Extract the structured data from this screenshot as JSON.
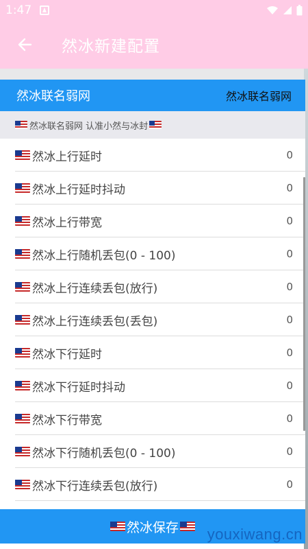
{
  "status_bar": {
    "time": "1:47",
    "icons": [
      "notification-icon",
      "wifi-icon",
      "signal-icon",
      "battery-icon"
    ]
  },
  "app_bar": {
    "back_icon": "arrow-left-icon",
    "title": "然冰新建配置"
  },
  "config": {
    "label": "然冰联名弱网",
    "value": "然冰联名弱网"
  },
  "section": {
    "text": "然冰联名弱网 认准小然与冰封"
  },
  "items": [
    {
      "label": "然冰上行延时",
      "value": "0"
    },
    {
      "label": "然冰上行延时抖动",
      "value": "0"
    },
    {
      "label": "然冰上行带宽",
      "value": "0"
    },
    {
      "label": "然冰上行随机丢包(0 - 100)",
      "value": "0"
    },
    {
      "label": "然冰上行连续丢包(放行)",
      "value": "0"
    },
    {
      "label": "然冰上行连续丢包(丢包)",
      "value": "0"
    },
    {
      "label": "然冰下行延时",
      "value": "0"
    },
    {
      "label": "然冰下行延时抖动",
      "value": "0"
    },
    {
      "label": "然冰下行带宽",
      "value": "0"
    },
    {
      "label": "然冰下行随机丢包(0 - 100)",
      "value": "0"
    },
    {
      "label": "然冰下行连续丢包(放行)",
      "value": "0"
    }
  ],
  "save": {
    "label": "然冰保存"
  },
  "watermark": "youxiwang.cn",
  "colors": {
    "app_bar": "#ffcce6",
    "accent": "#2196f3",
    "section_bg": "#e9e9ee"
  }
}
